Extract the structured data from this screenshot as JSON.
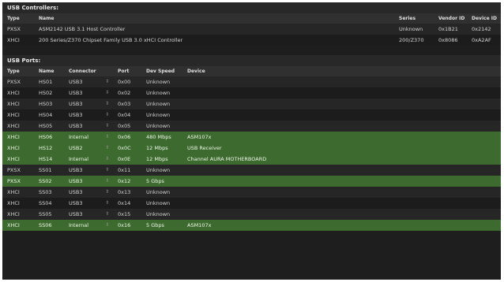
{
  "controllers": {
    "title": "USB Controllers:",
    "headers": {
      "type": "Type",
      "name": "Name",
      "series": "Series",
      "vendor_id": "Vendor ID",
      "device_id": "Device ID"
    },
    "rows": [
      {
        "type": "PXSX",
        "name": "ASM2142 USB 3.1 Host Controller",
        "series": "Unknown",
        "vendor_id": "0x1B21",
        "device_id": "0x2142"
      },
      {
        "type": "XHCI",
        "name": "200 Series/Z370 Chipset Family USB 3.0 xHCI Controller",
        "series": "200/Z370",
        "vendor_id": "0x8086",
        "device_id": "0xA2AF"
      }
    ]
  },
  "ports": {
    "title": "USB Ports:",
    "headers": {
      "type": "Type",
      "name": "Name",
      "connector": "Connector",
      "port": "Port",
      "dev_speed": "Dev Speed",
      "device": "Device"
    },
    "stepper_glyph": "⇳",
    "rows": [
      {
        "type": "PXSX",
        "name": "HS01",
        "connector": "USB3",
        "port": "0x00",
        "dev_speed": "Unknown",
        "device": "",
        "highlighted": false
      },
      {
        "type": "XHCI",
        "name": "HS02",
        "connector": "USB3",
        "port": "0x02",
        "dev_speed": "Unknown",
        "device": "",
        "highlighted": false
      },
      {
        "type": "XHCI",
        "name": "HS03",
        "connector": "USB3",
        "port": "0x03",
        "dev_speed": "Unknown",
        "device": "",
        "highlighted": false
      },
      {
        "type": "XHCI",
        "name": "HS04",
        "connector": "USB3",
        "port": "0x04",
        "dev_speed": "Unknown",
        "device": "",
        "highlighted": false
      },
      {
        "type": "XHCI",
        "name": "HS05",
        "connector": "USB3",
        "port": "0x05",
        "dev_speed": "Unknown",
        "device": "",
        "highlighted": false
      },
      {
        "type": "XHCI",
        "name": "HS06",
        "connector": "Internal",
        "port": "0x06",
        "dev_speed": "480 Mbps",
        "device": "ASM107x",
        "highlighted": true
      },
      {
        "type": "XHCI",
        "name": "HS12",
        "connector": "USB2",
        "port": "0x0C",
        "dev_speed": "12 Mbps",
        "device": "USB Receiver",
        "highlighted": true
      },
      {
        "type": "XHCI",
        "name": "HS14",
        "connector": "Internal",
        "port": "0x0E",
        "dev_speed": "12 Mbps",
        "device": "Channel AURA MOTHERBOARD",
        "highlighted": true
      },
      {
        "type": "PXSX",
        "name": "SS01",
        "connector": "USB3",
        "port": "0x11",
        "dev_speed": "Unknown",
        "device": "",
        "highlighted": false
      },
      {
        "type": "PXSX",
        "name": "SS02",
        "connector": "USB3",
        "port": "0x12",
        "dev_speed": "5 Gbps",
        "device": "",
        "highlighted": true
      },
      {
        "type": "XHCI",
        "name": "SS03",
        "connector": "USB3",
        "port": "0x13",
        "dev_speed": "Unknown",
        "device": "",
        "highlighted": false
      },
      {
        "type": "XHCI",
        "name": "SS04",
        "connector": "USB3",
        "port": "0x14",
        "dev_speed": "Unknown",
        "device": "",
        "highlighted": false
      },
      {
        "type": "XHCI",
        "name": "SS05",
        "connector": "USB3",
        "port": "0x15",
        "dev_speed": "Unknown",
        "device": "",
        "highlighted": false
      },
      {
        "type": "XHCI",
        "name": "SS06",
        "connector": "Internal",
        "port": "0x16",
        "dev_speed": "5 Gbps",
        "device": "ASM107x",
        "highlighted": true
      }
    ]
  },
  "colors": {
    "background": "#1e1e1e",
    "header": "#303030",
    "highlight": "#3d6b2f"
  }
}
